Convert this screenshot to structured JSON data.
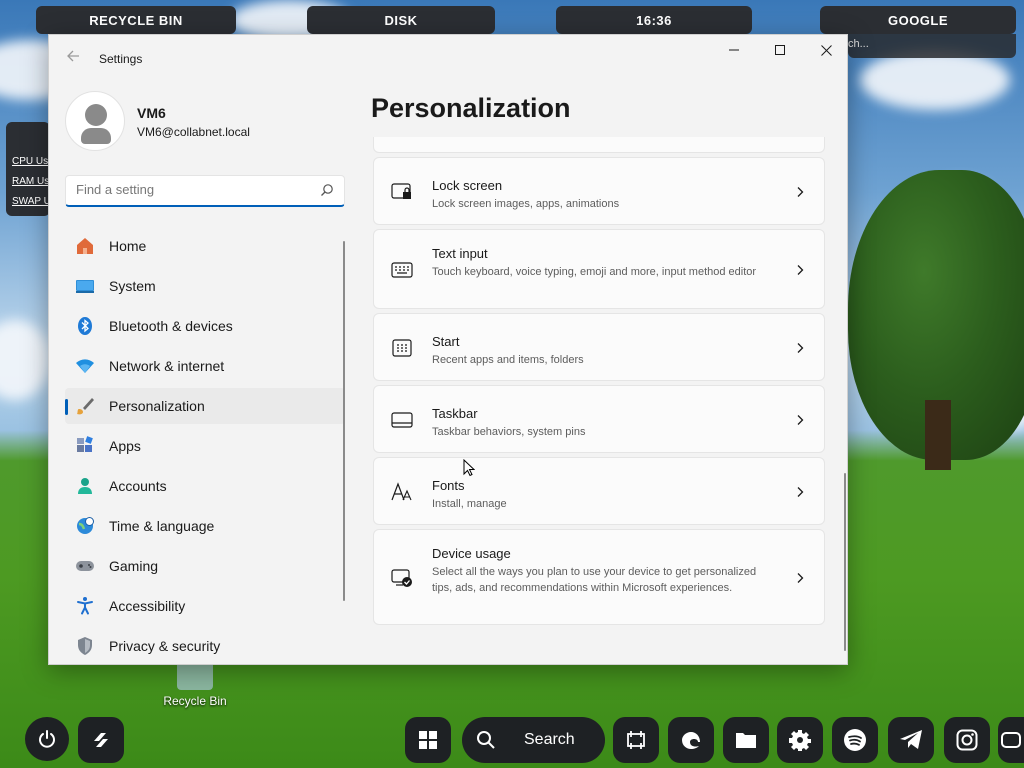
{
  "desktop": {
    "widgets": {
      "recycle_bin": "RECYCLE BIN",
      "disk": "DISK",
      "clock": "16:36",
      "google": "GOOGLE",
      "google_search_partial": "ch..."
    },
    "system_monitor": [
      "CPU Us",
      "RAM Us",
      "SWAP U"
    ],
    "recycle_bin_icon_label": "Recycle Bin"
  },
  "window": {
    "app_title": "Settings",
    "page_title": "Personalization",
    "profile": {
      "name": "VM6",
      "email": "VM6@collabnet.local"
    },
    "search": {
      "placeholder": "Find a setting",
      "value": ""
    },
    "nav": [
      {
        "label": "Home",
        "icon": "home-icon",
        "selected": false
      },
      {
        "label": "System",
        "icon": "system-icon",
        "selected": false
      },
      {
        "label": "Bluetooth & devices",
        "icon": "bluetooth-icon",
        "selected": false
      },
      {
        "label": "Network & internet",
        "icon": "network-icon",
        "selected": false
      },
      {
        "label": "Personalization",
        "icon": "brush-icon",
        "selected": true
      },
      {
        "label": "Apps",
        "icon": "apps-icon",
        "selected": false
      },
      {
        "label": "Accounts",
        "icon": "accounts-icon",
        "selected": false
      },
      {
        "label": "Time & language",
        "icon": "globe-clock-icon",
        "selected": false
      },
      {
        "label": "Gaming",
        "icon": "gamepad-icon",
        "selected": false
      },
      {
        "label": "Accessibility",
        "icon": "accessibility-icon",
        "selected": false
      },
      {
        "label": "Privacy & security",
        "icon": "shield-icon",
        "selected": false
      }
    ],
    "cards": [
      {
        "title": "Lock screen",
        "subtitle": "Lock screen images, apps, animations",
        "icon": "lock-screen-icon"
      },
      {
        "title": "Text input",
        "subtitle": "Touch keyboard, voice typing, emoji and more, input method editor",
        "icon": "keyboard-icon"
      },
      {
        "title": "Start",
        "subtitle": "Recent apps and items, folders",
        "icon": "start-icon"
      },
      {
        "title": "Taskbar",
        "subtitle": "Taskbar behaviors, system pins",
        "icon": "taskbar-icon"
      },
      {
        "title": "Fonts",
        "subtitle": "Install, manage",
        "icon": "fonts-icon"
      },
      {
        "title": "Device usage",
        "subtitle": "Select all the ways you plan to use your device to get personalized tips, ads, and recommendations within Microsoft experiences.",
        "icon": "device-usage-icon"
      }
    ]
  },
  "dock": {
    "search_label": "Search",
    "apps": [
      "windows-icon",
      "search-icon",
      "screenshot-icon",
      "edge-icon",
      "folder-icon",
      "settings-gear-icon",
      "spotify-icon",
      "telegram-icon",
      "instagram-icon",
      "youtube-icon"
    ]
  },
  "colors": {
    "accent": "#005fb8",
    "window_bg": "#f3f3f3",
    "card_bg": "#fbfbfb",
    "dock_bg": "#1e2124"
  }
}
